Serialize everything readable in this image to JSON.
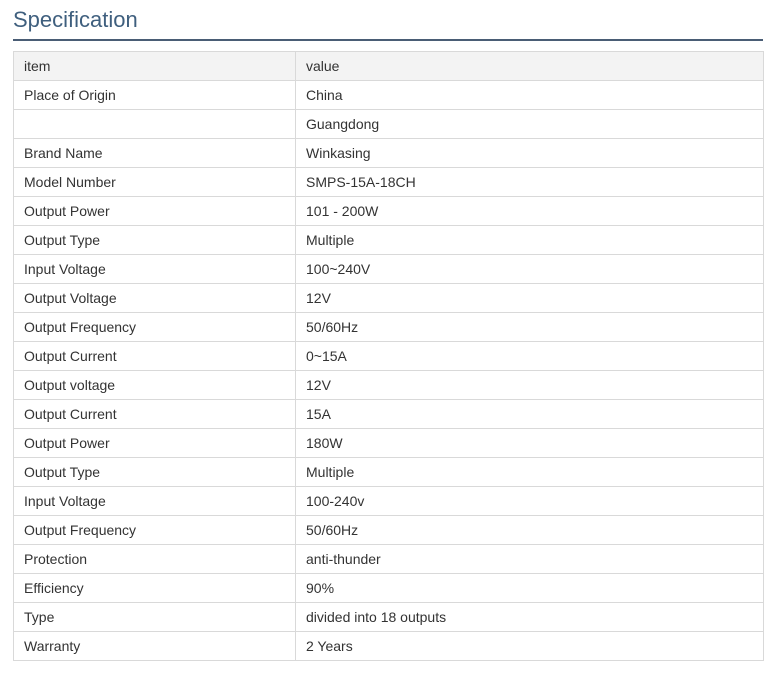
{
  "page_title": "Specification",
  "table": {
    "header": {
      "item": "item",
      "value": "value"
    },
    "rows": [
      {
        "item": "Place of Origin",
        "value": "China"
      },
      {
        "item": "",
        "value": "Guangdong"
      },
      {
        "item": "Brand Name",
        "value": "Winkasing"
      },
      {
        "item": "Model Number",
        "value": "SMPS-15A-18CH"
      },
      {
        "item": "Output Power",
        "value": "101 - 200W"
      },
      {
        "item": "Output Type",
        "value": "Multiple"
      },
      {
        "item": "Input Voltage",
        "value": "100~240V"
      },
      {
        "item": "Output Voltage",
        "value": "12V"
      },
      {
        "item": "Output Frequency",
        "value": "50/60Hz"
      },
      {
        "item": "Output Current",
        "value": "0~15A"
      },
      {
        "item": "Output voltage",
        "value": "12V"
      },
      {
        "item": "Output Current",
        "value": "15A"
      },
      {
        "item": "Output Power",
        "value": "180W"
      },
      {
        "item": "Output Type",
        "value": "Multiple"
      },
      {
        "item": "Input Voltage",
        "value": "100-240v"
      },
      {
        "item": "Output Frequency",
        "value": "50/60Hz"
      },
      {
        "item": "Protection",
        "value": "anti-thunder"
      },
      {
        "item": "Efficiency",
        "value": "90%"
      },
      {
        "item": "Type",
        "value": "divided into 18 outputs"
      },
      {
        "item": "Warranty",
        "value": "2 Years"
      }
    ]
  },
  "colors": {
    "title_text": "#3f5f7e",
    "title_rule": "#4a5d75",
    "header_background": "#f3f3f3",
    "border": "#d9d9d9",
    "cell_text": "#333333"
  }
}
